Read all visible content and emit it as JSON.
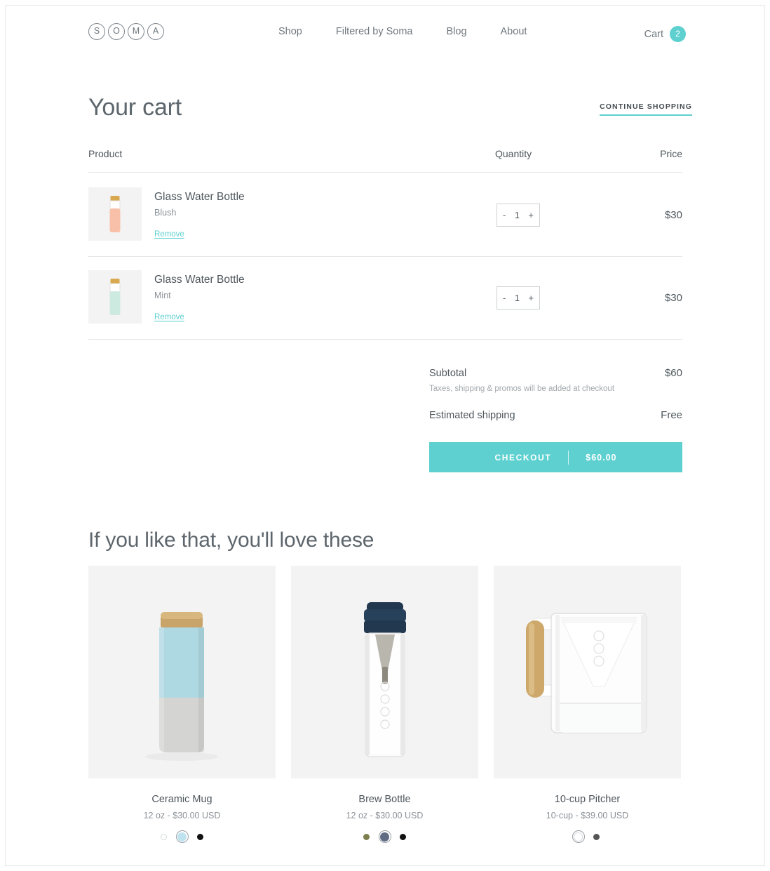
{
  "header": {
    "logo_letters": [
      "S",
      "O",
      "M",
      "A"
    ],
    "nav": [
      {
        "label": "Shop"
      },
      {
        "label": "Filtered by Soma"
      },
      {
        "label": "Blog"
      },
      {
        "label": "About"
      }
    ],
    "cart_label": "Cart",
    "cart_count": "2"
  },
  "cart": {
    "title": "Your cart",
    "continue_shopping": "CONTINUE SHOPPING",
    "columns": {
      "product": "Product",
      "quantity": "Quantity",
      "price": "Price"
    },
    "items": [
      {
        "title": "Glass Water Bottle",
        "variant": "Blush",
        "remove_label": "Remove",
        "quantity": "1",
        "decrement": "-",
        "increment": "+",
        "price": "$30",
        "sleeve_color": "#f8c0a8",
        "cap_color": "#d8a94f"
      },
      {
        "title": "Glass Water Bottle",
        "variant": "Mint",
        "remove_label": "Remove",
        "quantity": "1",
        "decrement": "-",
        "increment": "+",
        "price": "$30",
        "sleeve_color": "#cdeae0",
        "cap_color": "#d8a94f"
      }
    ],
    "summary": {
      "subtotal_label": "Subtotal",
      "subtotal_value": "$60",
      "note": "Taxes, shipping & promos will be added at checkout",
      "shipping_label": "Estimated shipping",
      "shipping_value": "Free",
      "checkout_label": "CHECKOUT",
      "checkout_total": "$60.00"
    }
  },
  "recommendations": {
    "title": "If you like that, you'll love these",
    "products": [
      {
        "name": "Ceramic Mug",
        "price": "12 oz - $30.00 USD",
        "image": "ceramic-mug",
        "swatches": [
          {
            "color": "#ffffff",
            "selected": false,
            "outlined": true
          },
          {
            "color": "#bfe2ef",
            "selected": true,
            "outlined": false
          },
          {
            "color": "#111111",
            "selected": false,
            "outlined": false
          }
        ]
      },
      {
        "name": "Brew Bottle",
        "price": "12 oz - $30.00 USD",
        "image": "brew-bottle",
        "swatches": [
          {
            "color": "#7d7f4c",
            "selected": false,
            "outlined": false
          },
          {
            "color": "#606b84",
            "selected": true,
            "outlined": false
          },
          {
            "color": "#111111",
            "selected": false,
            "outlined": false
          }
        ]
      },
      {
        "name": "10-cup Pitcher",
        "price": "10-cup - $39.00 USD",
        "image": "pitcher",
        "swatches": [
          {
            "color": "#ffffff",
            "selected": true,
            "outlined": true
          },
          {
            "color": "#555555",
            "selected": false,
            "outlined": false
          }
        ]
      }
    ]
  },
  "colors": {
    "accent": "#5ed0d0",
    "text": "#4e575d",
    "muted": "#8b9297",
    "rule": "#e4e6e8"
  }
}
